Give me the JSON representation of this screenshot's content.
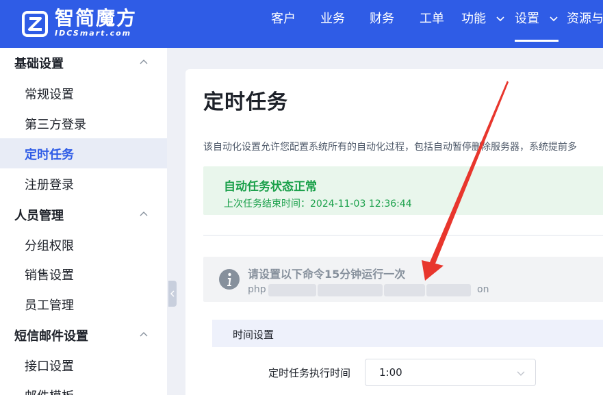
{
  "logo": {
    "name_cn": "智简魔方",
    "name_en": "IDCSmart.com"
  },
  "nav": {
    "items": [
      {
        "label": "客户"
      },
      {
        "label": "业务"
      },
      {
        "label": "财务"
      },
      {
        "label": "工单"
      },
      {
        "label": "功能",
        "has_dropdown": true
      },
      {
        "label": "设置",
        "has_dropdown": true,
        "active": true
      },
      {
        "label": "资源与"
      }
    ]
  },
  "sidebar": {
    "groups": [
      {
        "label": "基础设置",
        "items": [
          "常规设置",
          "第三方登录",
          "定时任务",
          "注册登录"
        ]
      },
      {
        "label": "人员管理",
        "items": [
          "分组权限",
          "销售设置",
          "员工管理"
        ]
      },
      {
        "label": "短信邮件设置",
        "items": [
          "接口设置",
          "邮件模板"
        ]
      }
    ],
    "active_item": "定时任务"
  },
  "main": {
    "title": "定时任务",
    "description": "该自动化设置允许您配置系统所有的自动化过程，包括自动暂停删除服务器，系统提前多",
    "status": {
      "title": "自动任务状态正常",
      "last_run": "上次任务结束时间：2024-11-03 12:36:44"
    },
    "command": {
      "title": "请设置以下命令15分钟运行一次",
      "prefix": "php",
      "suffix": "on"
    },
    "time_settings": {
      "header": "时间设置",
      "label": "定时任务执行时间",
      "value": "1:00"
    }
  },
  "colors": {
    "primary": "#2f5ce6",
    "success": "#1aa04a",
    "annotation_arrow": "#e8362d"
  }
}
